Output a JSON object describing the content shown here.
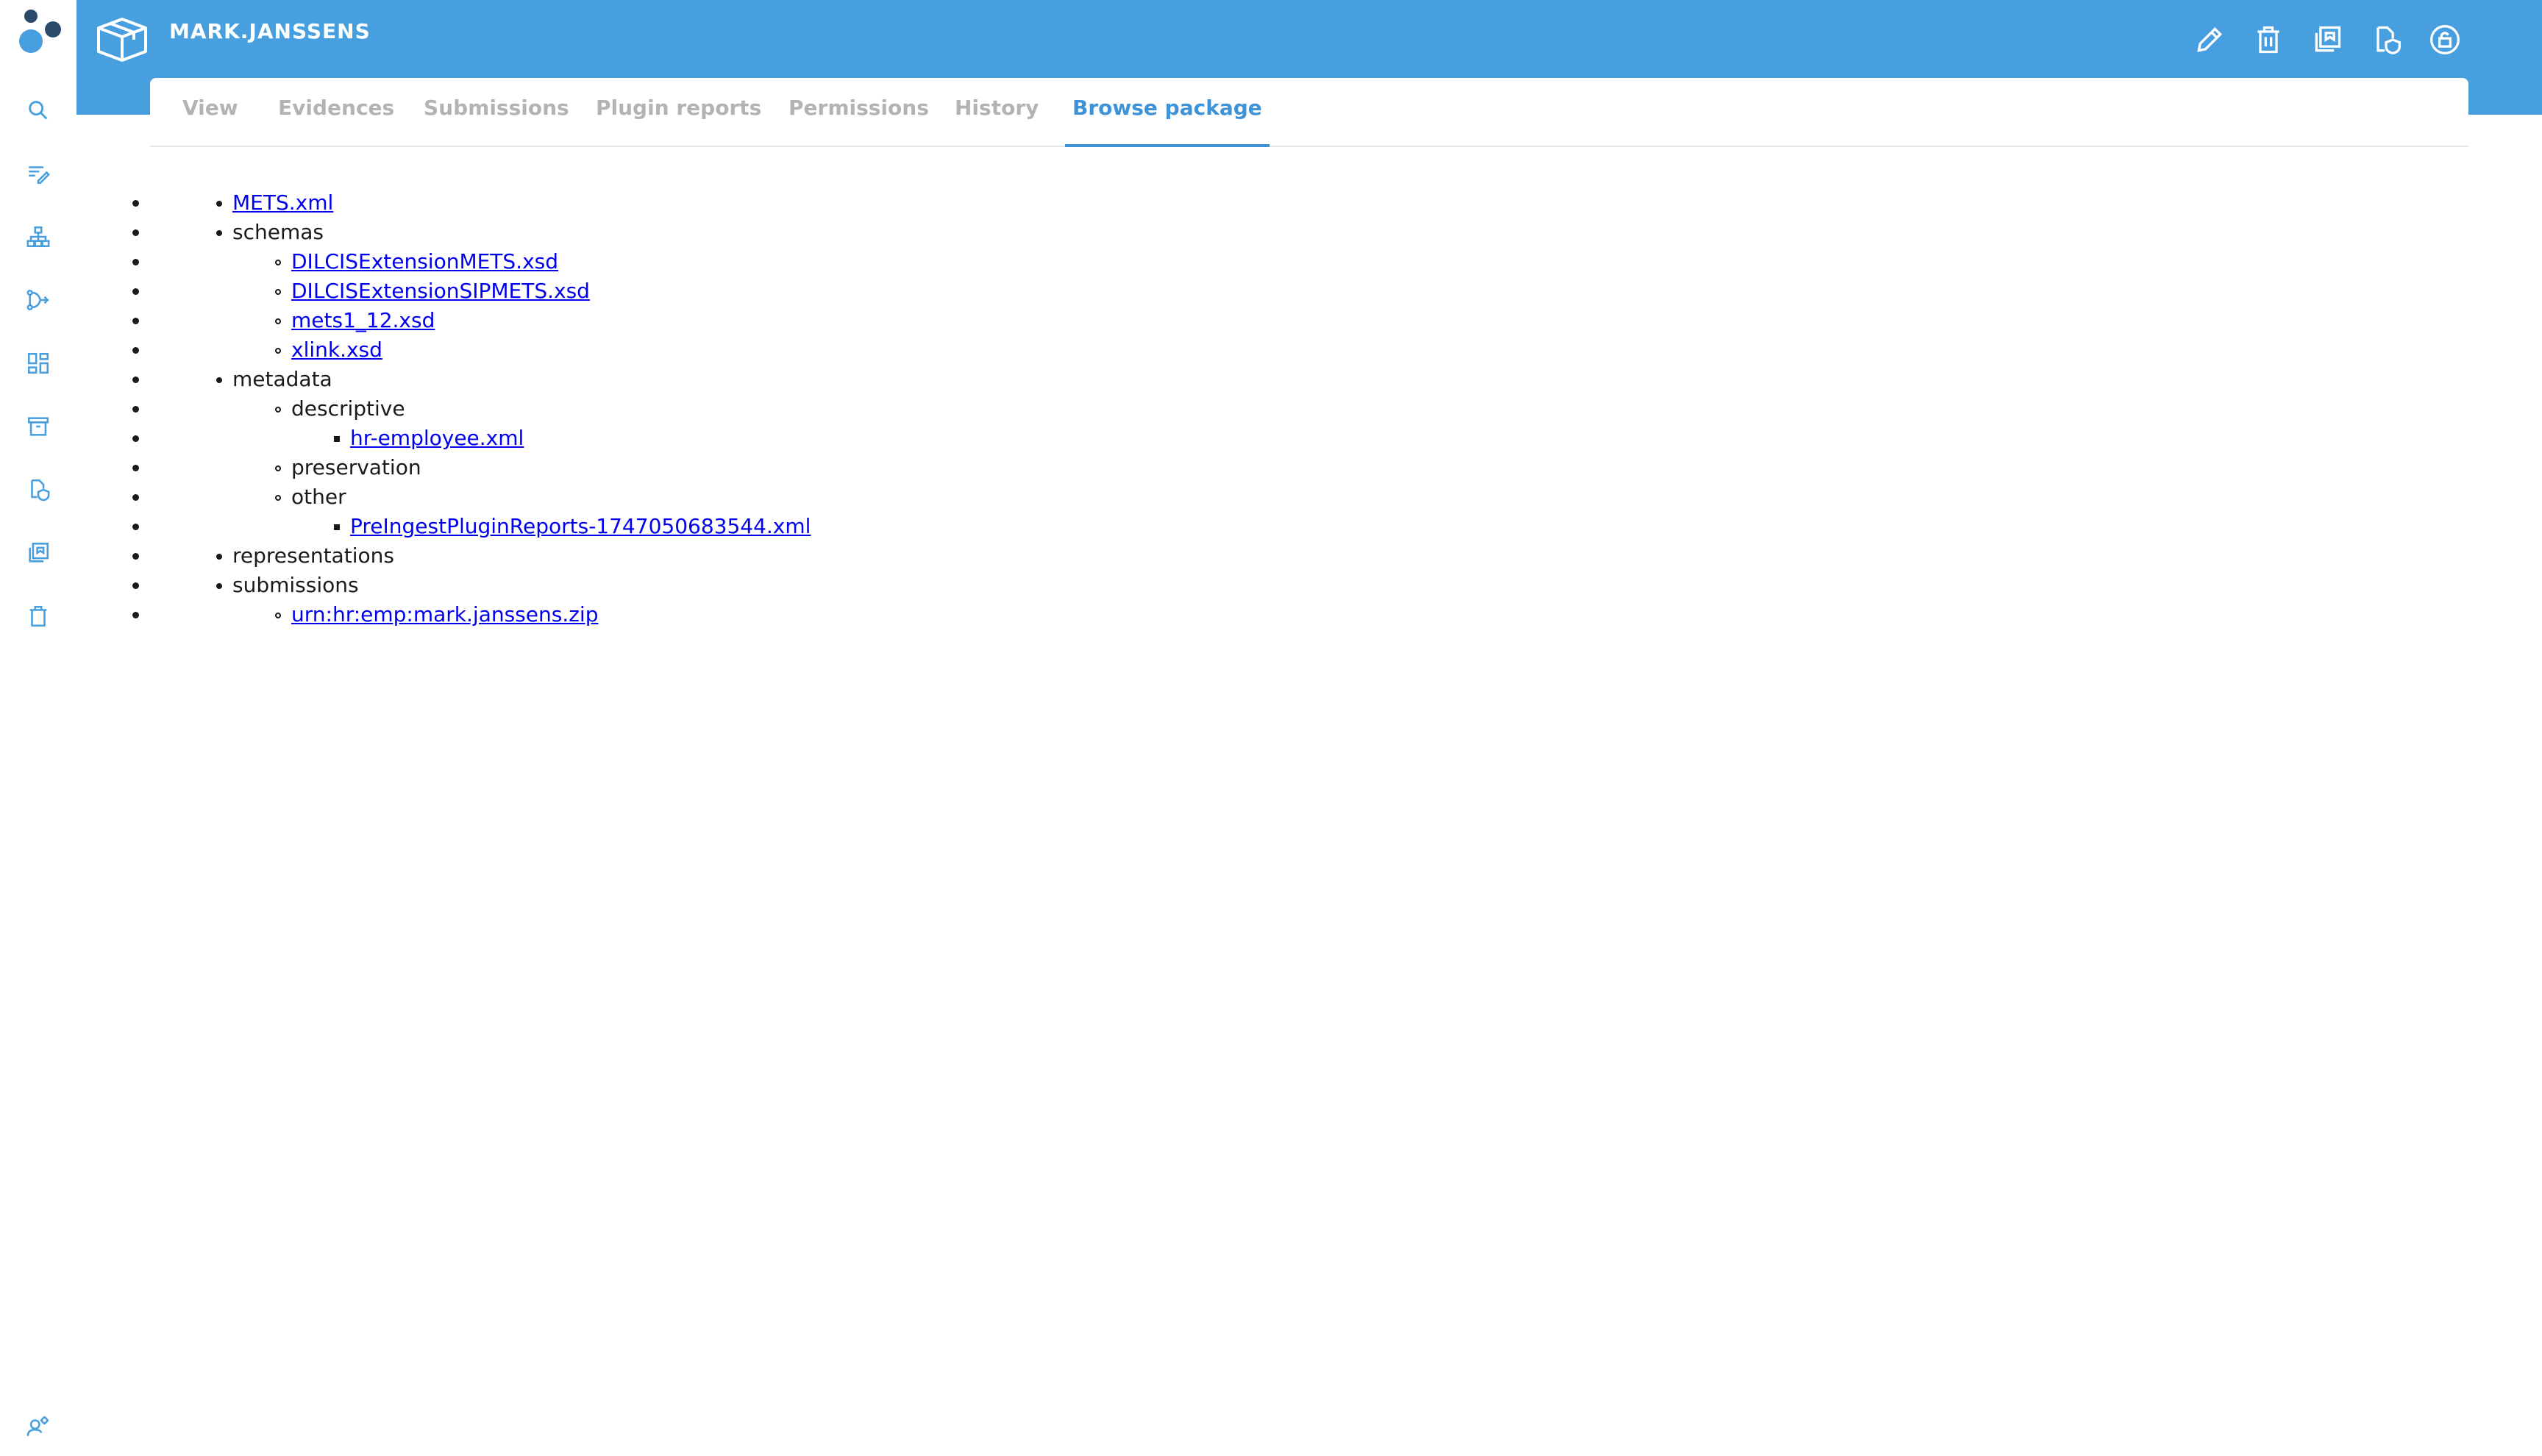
{
  "header": {
    "title": "MARK.JANSSENS",
    "colors": {
      "band": "#489fdf",
      "active_tab": "#3d92d8",
      "link": "#0000ee"
    }
  },
  "sidebar": {
    "icons": [
      "search-icon",
      "catalogue-icon",
      "hierarchy-icon",
      "ingest-icon",
      "dashboard-icon",
      "archive-icon",
      "preservation-icon",
      "representations-icon",
      "trash-icon",
      "user-settings-icon"
    ]
  },
  "actions": [
    "edit-icon",
    "delete-icon",
    "copy-icon",
    "preservation-icon",
    "lock-icon"
  ],
  "tabs": [
    {
      "label": "View"
    },
    {
      "label": "Evidences"
    },
    {
      "label": "Submissions"
    },
    {
      "label": "Plugin reports"
    },
    {
      "label": "Permissions"
    },
    {
      "label": "History"
    },
    {
      "label": "Browse package",
      "active": true
    }
  ],
  "tree": {
    "mets": "METS.xml",
    "schemas": {
      "label": "schemas",
      "files": [
        "DILCISExtensionMETS.xsd",
        "DILCISExtensionSIPMETS.xsd",
        "mets1_12.xsd",
        "xlink.xsd"
      ]
    },
    "metadata": {
      "label": "metadata",
      "descriptive": {
        "label": "descriptive",
        "files": [
          "hr-employee.xml"
        ]
      },
      "preservation": {
        "label": "preservation"
      },
      "other": {
        "label": "other",
        "files": [
          "PreIngestPluginReports-1747050683544.xml"
        ]
      }
    },
    "representations": {
      "label": "representations"
    },
    "submissions": {
      "label": "submissions",
      "files": [
        "urn:hr:emp:mark.janssens.zip"
      ]
    }
  }
}
